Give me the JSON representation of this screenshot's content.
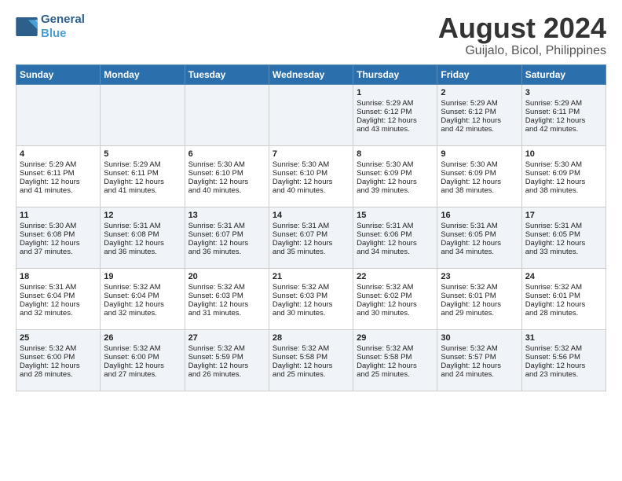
{
  "logo": {
    "line1": "General",
    "line2": "Blue"
  },
  "title": "August 2024",
  "subtitle": "Guijalo, Bicol, Philippines",
  "headers": [
    "Sunday",
    "Monday",
    "Tuesday",
    "Wednesday",
    "Thursday",
    "Friday",
    "Saturday"
  ],
  "weeks": [
    [
      {
        "day": "",
        "content": ""
      },
      {
        "day": "",
        "content": ""
      },
      {
        "day": "",
        "content": ""
      },
      {
        "day": "",
        "content": ""
      },
      {
        "day": "1",
        "content": "Sunrise: 5:29 AM\nSunset: 6:12 PM\nDaylight: 12 hours\nand 43 minutes."
      },
      {
        "day": "2",
        "content": "Sunrise: 5:29 AM\nSunset: 6:12 PM\nDaylight: 12 hours\nand 42 minutes."
      },
      {
        "day": "3",
        "content": "Sunrise: 5:29 AM\nSunset: 6:11 PM\nDaylight: 12 hours\nand 42 minutes."
      }
    ],
    [
      {
        "day": "4",
        "content": "Sunrise: 5:29 AM\nSunset: 6:11 PM\nDaylight: 12 hours\nand 41 minutes."
      },
      {
        "day": "5",
        "content": "Sunrise: 5:29 AM\nSunset: 6:11 PM\nDaylight: 12 hours\nand 41 minutes."
      },
      {
        "day": "6",
        "content": "Sunrise: 5:30 AM\nSunset: 6:10 PM\nDaylight: 12 hours\nand 40 minutes."
      },
      {
        "day": "7",
        "content": "Sunrise: 5:30 AM\nSunset: 6:10 PM\nDaylight: 12 hours\nand 40 minutes."
      },
      {
        "day": "8",
        "content": "Sunrise: 5:30 AM\nSunset: 6:09 PM\nDaylight: 12 hours\nand 39 minutes."
      },
      {
        "day": "9",
        "content": "Sunrise: 5:30 AM\nSunset: 6:09 PM\nDaylight: 12 hours\nand 38 minutes."
      },
      {
        "day": "10",
        "content": "Sunrise: 5:30 AM\nSunset: 6:09 PM\nDaylight: 12 hours\nand 38 minutes."
      }
    ],
    [
      {
        "day": "11",
        "content": "Sunrise: 5:30 AM\nSunset: 6:08 PM\nDaylight: 12 hours\nand 37 minutes."
      },
      {
        "day": "12",
        "content": "Sunrise: 5:31 AM\nSunset: 6:08 PM\nDaylight: 12 hours\nand 36 minutes."
      },
      {
        "day": "13",
        "content": "Sunrise: 5:31 AM\nSunset: 6:07 PM\nDaylight: 12 hours\nand 36 minutes."
      },
      {
        "day": "14",
        "content": "Sunrise: 5:31 AM\nSunset: 6:07 PM\nDaylight: 12 hours\nand 35 minutes."
      },
      {
        "day": "15",
        "content": "Sunrise: 5:31 AM\nSunset: 6:06 PM\nDaylight: 12 hours\nand 34 minutes."
      },
      {
        "day": "16",
        "content": "Sunrise: 5:31 AM\nSunset: 6:05 PM\nDaylight: 12 hours\nand 34 minutes."
      },
      {
        "day": "17",
        "content": "Sunrise: 5:31 AM\nSunset: 6:05 PM\nDaylight: 12 hours\nand 33 minutes."
      }
    ],
    [
      {
        "day": "18",
        "content": "Sunrise: 5:31 AM\nSunset: 6:04 PM\nDaylight: 12 hours\nand 32 minutes."
      },
      {
        "day": "19",
        "content": "Sunrise: 5:32 AM\nSunset: 6:04 PM\nDaylight: 12 hours\nand 32 minutes."
      },
      {
        "day": "20",
        "content": "Sunrise: 5:32 AM\nSunset: 6:03 PM\nDaylight: 12 hours\nand 31 minutes."
      },
      {
        "day": "21",
        "content": "Sunrise: 5:32 AM\nSunset: 6:03 PM\nDaylight: 12 hours\nand 30 minutes."
      },
      {
        "day": "22",
        "content": "Sunrise: 5:32 AM\nSunset: 6:02 PM\nDaylight: 12 hours\nand 30 minutes."
      },
      {
        "day": "23",
        "content": "Sunrise: 5:32 AM\nSunset: 6:01 PM\nDaylight: 12 hours\nand 29 minutes."
      },
      {
        "day": "24",
        "content": "Sunrise: 5:32 AM\nSunset: 6:01 PM\nDaylight: 12 hours\nand 28 minutes."
      }
    ],
    [
      {
        "day": "25",
        "content": "Sunrise: 5:32 AM\nSunset: 6:00 PM\nDaylight: 12 hours\nand 28 minutes."
      },
      {
        "day": "26",
        "content": "Sunrise: 5:32 AM\nSunset: 6:00 PM\nDaylight: 12 hours\nand 27 minutes."
      },
      {
        "day": "27",
        "content": "Sunrise: 5:32 AM\nSunset: 5:59 PM\nDaylight: 12 hours\nand 26 minutes."
      },
      {
        "day": "28",
        "content": "Sunrise: 5:32 AM\nSunset: 5:58 PM\nDaylight: 12 hours\nand 25 minutes."
      },
      {
        "day": "29",
        "content": "Sunrise: 5:32 AM\nSunset: 5:58 PM\nDaylight: 12 hours\nand 25 minutes."
      },
      {
        "day": "30",
        "content": "Sunrise: 5:32 AM\nSunset: 5:57 PM\nDaylight: 12 hours\nand 24 minutes."
      },
      {
        "day": "31",
        "content": "Sunrise: 5:32 AM\nSunset: 5:56 PM\nDaylight: 12 hours\nand 23 minutes."
      }
    ]
  ]
}
